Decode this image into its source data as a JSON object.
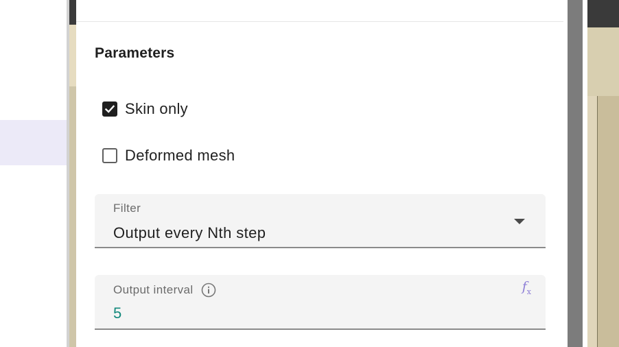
{
  "section": {
    "title": "Parameters"
  },
  "checkboxes": [
    {
      "label": "Skin only",
      "checked": true
    },
    {
      "label": "Deformed mesh",
      "checked": false
    }
  ],
  "filter": {
    "label": "Filter",
    "value": "Output every Nth step",
    "icon": "dropdown-arrow-icon"
  },
  "output_interval": {
    "label": "Output interval",
    "value": "5",
    "info_icon": "info-icon",
    "fx_icon": "function-icon",
    "value_color": "#13897c"
  },
  "colors": {
    "accent": "#8d7ed6",
    "highlight": "#eceaf8"
  }
}
